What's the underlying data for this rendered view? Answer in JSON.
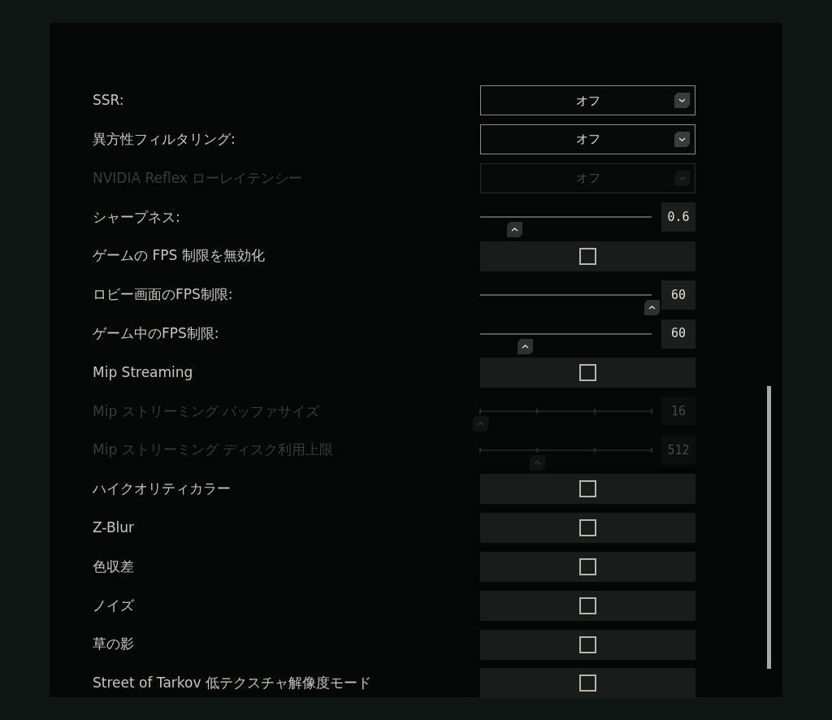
{
  "settings": [
    {
      "label": "SSR:",
      "kind": "select",
      "disabled": false,
      "value": "オフ"
    },
    {
      "label": "異方性フィルタリング:",
      "kind": "select",
      "disabled": false,
      "value": "オフ"
    },
    {
      "label": "NVIDIA Reflex ローレイテンシー",
      "kind": "select",
      "disabled": true,
      "value": "オフ"
    },
    {
      "label": "シャープネス:",
      "kind": "slider",
      "disabled": false,
      "stepped": false,
      "level": 0.2,
      "value": "0.6"
    },
    {
      "label": "ゲームの FPS 制限を無効化",
      "kind": "checkbox",
      "disabled": false,
      "checked": false
    },
    {
      "label": "ロビー画面のFPS制限:",
      "kind": "slider",
      "disabled": false,
      "stepped": false,
      "level": 1,
      "value": "60"
    },
    {
      "label": "ゲーム中のFPS制限:",
      "kind": "slider",
      "disabled": false,
      "stepped": false,
      "level": 0.26,
      "value": "60"
    },
    {
      "label": "Mip Streaming",
      "kind": "checkbox",
      "disabled": false,
      "checked": false
    },
    {
      "label": "Mip ストリーミング バッファサイズ",
      "kind": "slider",
      "disabled": true,
      "stepped": true,
      "level": 0,
      "value": "16"
    },
    {
      "label": "Mip ストリーミング ディスク利用上限",
      "kind": "slider",
      "disabled": true,
      "stepped": true,
      "level": 0.33,
      "value": "512"
    },
    {
      "label": "ハイクオリティカラー",
      "kind": "checkbox",
      "disabled": false,
      "checked": false
    },
    {
      "label": "Z-Blur",
      "kind": "checkbox",
      "disabled": false,
      "checked": false
    },
    {
      "label": "色収差",
      "kind": "checkbox",
      "disabled": false,
      "checked": false
    },
    {
      "label": "ノイズ",
      "kind": "checkbox",
      "disabled": false,
      "checked": false
    },
    {
      "label": "草の影",
      "kind": "checkbox",
      "disabled": false,
      "checked": false
    },
    {
      "label": "Street of Tarkov 低テクスチャ解像度モード",
      "kind": "checkbox",
      "disabled": false,
      "checked": false
    }
  ]
}
